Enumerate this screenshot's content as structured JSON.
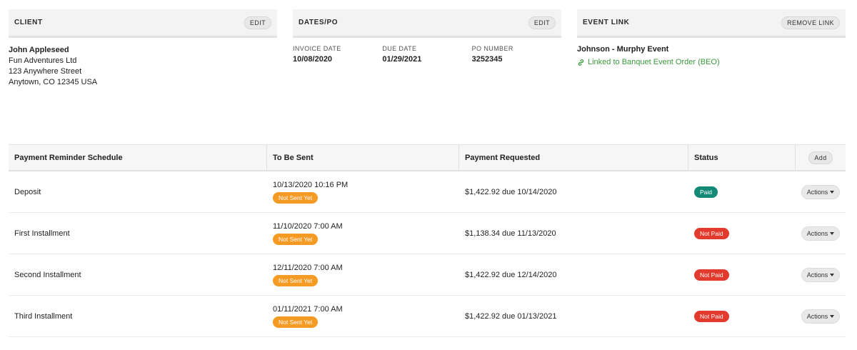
{
  "client_card": {
    "title": "CLIENT",
    "edit_label": "EDIT",
    "name": "John Appleseed",
    "company": "Fun Adventures Ltd",
    "street": "123 Anywhere Street",
    "city": "Anytown, CO 12345 USA"
  },
  "dates_card": {
    "title": "DATES/PO",
    "edit_label": "EDIT",
    "invoice_date_label": "INVOICE DATE",
    "invoice_date": "10/08/2020",
    "due_date_label": "DUE DATE",
    "due_date": "01/29/2021",
    "po_label": "PO NUMBER",
    "po_number": "3252345"
  },
  "event_card": {
    "title": "EVENT LINK",
    "remove_label": "REMOVE LINK",
    "event_name": "Johnson - Murphy Event",
    "link_text": "Linked to Banquet Event Order (BEO)",
    "link_color": "#3c9a3c"
  },
  "table": {
    "headers": {
      "schedule": "Payment Reminder Schedule",
      "to_be_sent": "To Be Sent",
      "payment_requested": "Payment Requested",
      "status": "Status",
      "add_label": "Add"
    },
    "actions_label": "Actions",
    "rows": [
      {
        "name": "Deposit",
        "sent_time": "10/13/2020 10:16 PM",
        "sent_badge": "Not Sent Yet",
        "payment": "$1,422.92 due 10/14/2020",
        "status": "Paid"
      },
      {
        "name": "First Installment",
        "sent_time": "11/10/2020 7:00 AM",
        "sent_badge": "Not Sent Yet",
        "payment": "$1,138.34 due 11/13/2020",
        "status": "Not Paid"
      },
      {
        "name": "Second Installment",
        "sent_time": "12/11/2020 7:00 AM",
        "sent_badge": "Not Sent Yet",
        "payment": "$1,422.92 due 12/14/2020",
        "status": "Not Paid"
      },
      {
        "name": "Third Installment",
        "sent_time": "01/11/2021 7:00 AM",
        "sent_badge": "Not Sent Yet",
        "payment": "$1,422.92 due 01/13/2021",
        "status": "Not Paid"
      }
    ]
  },
  "colors": {
    "badge_not_sent": "#f59a23",
    "badge_paid": "#138a76",
    "badge_not_paid": "#e23a2c"
  }
}
